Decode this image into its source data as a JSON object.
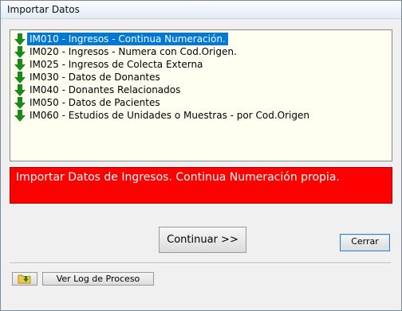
{
  "window": {
    "title": "Importar Datos"
  },
  "list": {
    "items": [
      {
        "label": "IM010 - Ingresos - Continua Numeración.",
        "selected": true
      },
      {
        "label": "IM020 - Ingresos - Numera con Cod.Origen.",
        "selected": false
      },
      {
        "label": "IM025 - Ingresos de Colecta Externa",
        "selected": false
      },
      {
        "label": "IM030 - Datos de Donantes",
        "selected": false
      },
      {
        "label": "IM040 - Donantes Relacionados",
        "selected": false
      },
      {
        "label": "IM050 - Datos de Pacientes",
        "selected": false
      },
      {
        "label": "IM060 - Estudios de Unidades o Muestras - por Cod.Origen",
        "selected": false
      }
    ]
  },
  "description": {
    "text": "Importar Datos de Ingresos. Continua Numeración propia."
  },
  "buttons": {
    "continuar_label": "Continuar >>",
    "cerrar_label": "Cerrar",
    "log_label": "Ver Log de Proceso"
  },
  "colors": {
    "description_bg": "#ff0000",
    "selection_bg": "#0078d7",
    "list_bg": "#fffef0",
    "arrow": "#1a8a1a"
  },
  "icons": {
    "list_item": "green-down-arrow-icon",
    "folder": "folder-arrow-icon"
  }
}
